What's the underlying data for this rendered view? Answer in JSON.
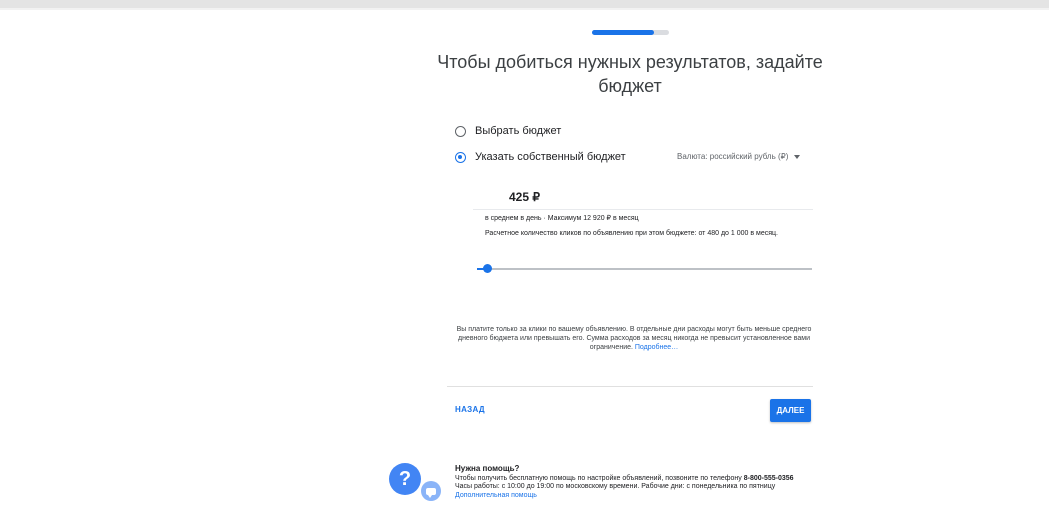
{
  "progress": {
    "fraction": 0.8
  },
  "title": "Чтобы добиться нужных результатов, задайте бюджет",
  "options": [
    {
      "label": "Выбрать бюджет",
      "checked": false
    },
    {
      "label": "Указать собственный бюджет",
      "checked": true
    }
  ],
  "currency": {
    "label": "Валюта: российский рубль (₽)"
  },
  "budget": {
    "amount": "425 ₽",
    "daily_text": "в среднем в день · Максимум 12 920 ₽ в месяц",
    "clicks_text": "Расчетное количество кликов по объявлению при этом бюджете: от 480 до 1 000 в месяц.",
    "slider_fraction": 0.03
  },
  "disclaimer": {
    "text": "Вы платите только за клики по вашему объявлению. В отдельные дни расходы могут быть меньше среднего дневного бюджета или превышать его. Сумма расходов за месяц никогда не превысит установленное вами ограничение. ",
    "link": "Подробнее…"
  },
  "nav": {
    "back_label": "НАЗАД",
    "next_label": "ДАЛЕЕ"
  },
  "help": {
    "title": "Нужна помощь?",
    "line1": "Чтобы получить бесплатную помощь по настройке объявлений, позвоните по телефону ",
    "phone": "8-800-555-0356",
    "line2": "Часы работы: с 10:00 до 19:00 по московскому времени. Рабочие дни: с понедельника по пятницу",
    "link": "Дополнительная помощь"
  },
  "colors": {
    "accent": "#1a73e8"
  },
  "icons": {
    "help": "question-icon",
    "chat": "chat-icon",
    "currency_dropdown": "caret-down-icon"
  }
}
